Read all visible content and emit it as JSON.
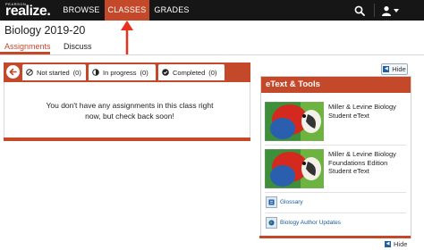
{
  "brand": {
    "logo_small": "PEARSON",
    "logo_main": "realize."
  },
  "nav": {
    "items": [
      {
        "label": "BROWSE"
      },
      {
        "label": "CLASSES"
      },
      {
        "label": "GRADES"
      }
    ],
    "active": "CLASSES",
    "search_icon": "search-icon",
    "user_icon": "user-icon"
  },
  "page": {
    "title": "Biology 2019-20",
    "tabs": [
      {
        "label": "Assignments",
        "active": true
      },
      {
        "label": "Discuss",
        "active": false
      }
    ]
  },
  "filters": {
    "items": [
      {
        "label": "Not started",
        "count": "(0)",
        "icon": "not-started-icon"
      },
      {
        "label": "In progress",
        "count": "(0)",
        "icon": "in-progress-icon"
      },
      {
        "label": "Completed",
        "count": "(0)",
        "icon": "completed-icon"
      }
    ]
  },
  "empty_message": "You don't have any assignments in this class right now, but check back soon!",
  "hide_label": "Hide",
  "etext_tools": {
    "title": "eText & Tools",
    "books": [
      {
        "title": "Miller & Levine Biology Student eText"
      },
      {
        "title": "Miller & Levine Biology Foundations Edition Student eText"
      }
    ],
    "tools": [
      {
        "label": "Glossary",
        "icon": "glossary-icon"
      },
      {
        "label": "Biology Author Updates",
        "icon": "author-updates-icon"
      }
    ]
  },
  "colors": {
    "accent": "#c4492b",
    "nav_bg": "#161616",
    "link": "#1a5aa0",
    "annotation_arrow": "#e8321e"
  }
}
